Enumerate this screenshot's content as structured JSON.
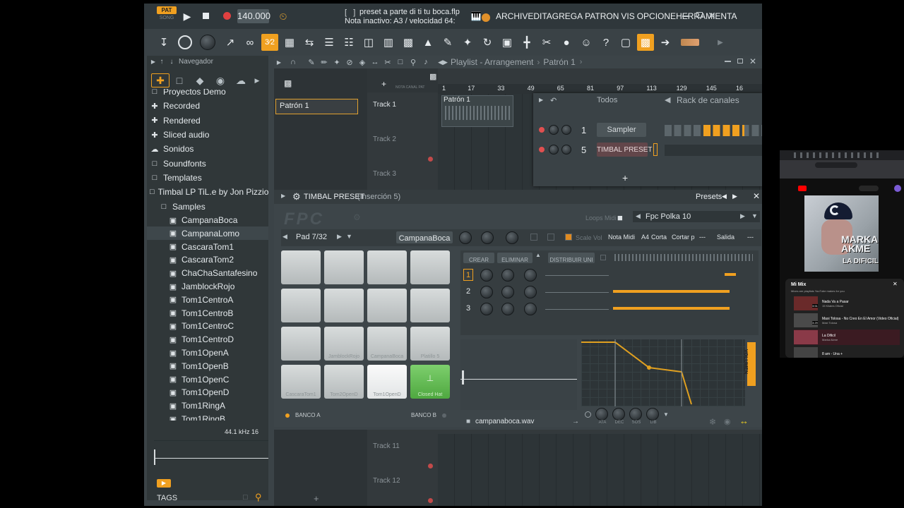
{
  "title_bar": {
    "pat_label": "PAT",
    "song_label": "SONG",
    "tempo": "140.000",
    "file_title": "preset a parte di ti tu boca.flp",
    "hint": "Nota inactivo: A3 / velocidad 64:",
    "menu": [
      "ARCHIV",
      "EDITA",
      "GREGA",
      "PATRON",
      "VIS",
      "OPCIONE",
      "HERRAMIENTA"
    ]
  },
  "browser": {
    "header": "Navegador",
    "items": [
      {
        "icon": "folder",
        "label": "Proyectos Demo",
        "indent": 0
      },
      {
        "icon": "plus",
        "label": "Recorded",
        "indent": 0
      },
      {
        "icon": "plus",
        "label": "Rendered",
        "indent": 0
      },
      {
        "icon": "plus",
        "label": "Sliced audio",
        "indent": 0
      },
      {
        "icon": "cloud",
        "label": "Sonidos",
        "indent": 0
      },
      {
        "icon": "folder",
        "label": "Soundfonts",
        "indent": 0
      },
      {
        "icon": "folder",
        "label": "Templates",
        "indent": 0
      },
      {
        "icon": "folder-open",
        "label": "Timbal LP TiL.e by Jon Pizzio",
        "indent": 0
      },
      {
        "icon": "folder-open",
        "label": "Samples",
        "indent": 1
      },
      {
        "icon": "file",
        "label": "CampanaBoca",
        "indent": 2
      },
      {
        "icon": "file",
        "label": "CampanaLomo",
        "indent": 2
      },
      {
        "icon": "file",
        "label": "CascaraTom1",
        "indent": 2
      },
      {
        "icon": "file",
        "label": "CascaraTom2",
        "indent": 2
      },
      {
        "icon": "file",
        "label": "ChaChaSantafesino",
        "indent": 2
      },
      {
        "icon": "file",
        "label": "JamblockRojo",
        "indent": 2
      },
      {
        "icon": "file",
        "label": "Tom1CentroA",
        "indent": 2
      },
      {
        "icon": "file",
        "label": "Tom1CentroB",
        "indent": 2
      },
      {
        "icon": "file",
        "label": "Tom1CentroC",
        "indent": 2
      },
      {
        "icon": "file",
        "label": "Tom1CentroD",
        "indent": 2
      },
      {
        "icon": "file",
        "label": "Tom1OpenA",
        "indent": 2
      },
      {
        "icon": "file",
        "label": "Tom1OpenB",
        "indent": 2
      },
      {
        "icon": "file",
        "label": "Tom1OpenC",
        "indent": 2
      },
      {
        "icon": "file",
        "label": "Tom1OpenD",
        "indent": 2
      },
      {
        "icon": "file",
        "label": "Tom1RingA",
        "indent": 2
      },
      {
        "icon": "file",
        "label": "Tom1RingB",
        "indent": 2
      }
    ],
    "sample_info": "44.1 kHz 16",
    "tags_label": "TAGS"
  },
  "playlist": {
    "title": "Playlist - Arrangement",
    "pattern_crumb": "Patrón 1",
    "pattern_item": "Patrón 1",
    "clip_label": "Patrón 1",
    "ruler": [
      "1",
      "17",
      "33",
      "49",
      "65",
      "81",
      "97",
      "113",
      "129",
      "145",
      "16"
    ],
    "tracks_top": [
      "Track 1",
      "Track 2",
      "Track 3"
    ],
    "tracks_bottom": [
      "Track 11",
      "Track 12"
    ]
  },
  "channel_rack": {
    "filter": "Todos",
    "title": "Rack de canales",
    "channels": [
      {
        "num": "1",
        "name": "Sampler"
      },
      {
        "num": "5",
        "name": "TIMBAL PRESET"
      }
    ]
  },
  "fpc": {
    "title": "TIMBAL PRESET",
    "insert": "(Inserción 5)",
    "presets_label": "Presets",
    "loops_label": "Loops Midi",
    "preset_name": "Fpc Polka 10",
    "pad_counter": "Pad 7/32",
    "pad_name": "CampanaBoca",
    "scale_label": "Scale Vol",
    "nota_label": "Nota Midi",
    "nota_value": "A4",
    "corta_label": "Corta",
    "cortar_label": "Cortar p",
    "cortar_value": "---",
    "salida_label": "Salida",
    "salida_value": "---",
    "btn_crear": "CREAR",
    "btn_eliminar": "ELIMINAR",
    "btn_distribuir": "DISTRIBUIR UNI",
    "layers": [
      "1",
      "2",
      "3"
    ],
    "pads": [
      "",
      "",
      "",
      "",
      "",
      "",
      "",
      "",
      "",
      "JamblockRojo",
      "CampanaBoca",
      "Platillo 5",
      "CascaraTom1",
      "Tom2OpenD",
      "Tom1OpenD",
      "Closed Hat"
    ],
    "bank_a": "BANCO A",
    "bank_b": "BANCO B",
    "sample_file": "campanaboca.wav",
    "env_labels": [
      "ATA",
      "DEC",
      "SOS",
      "LIB"
    ],
    "volume_label": "VOLUMEN"
  },
  "youtube": {
    "album_artist": "MARKA AKME",
    "album_title": "LA DIFICIL",
    "mix_title": "Mi Mix",
    "mix_sub": "Mixes are playlists YouTube makes for you",
    "items": [
      {
        "title": "Nada Va a Pasar",
        "sub": "15 Kilates Oficial",
        "time": "3:51"
      },
      {
        "title": "Maxi Tolosa - No Creo En El Amor (Video Oficial)",
        "sub": "Maxi Tolosa",
        "time": "3:29"
      },
      {
        "title": "La Dificil",
        "sub": "Marka Akme",
        "time": ""
      },
      {
        "title": "8 am - Una +",
        "sub": "",
        "time": ""
      }
    ]
  }
}
